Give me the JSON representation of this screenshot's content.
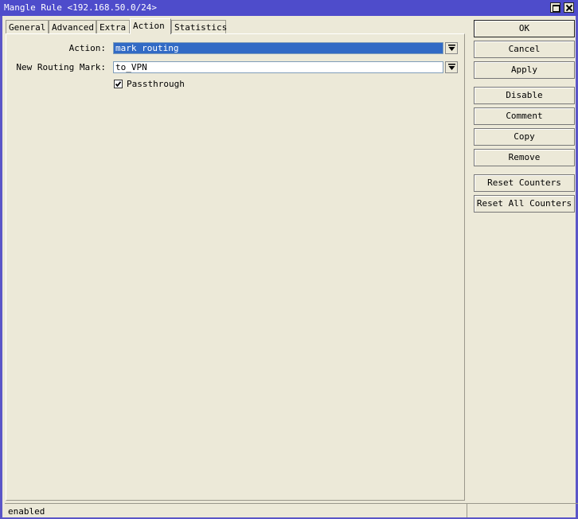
{
  "window": {
    "title": "Mangle Rule <192.168.50.0/24>"
  },
  "tabs": [
    {
      "label": "General"
    },
    {
      "label": "Advanced"
    },
    {
      "label": "Extra"
    },
    {
      "label": "Action",
      "active": true
    },
    {
      "label": "Statistics"
    }
  ],
  "form": {
    "action_label": "Action:",
    "action_value": "mark routing",
    "routing_mark_label": "New Routing Mark:",
    "routing_mark_value": "to_VPN",
    "passthrough_label": "Passthrough",
    "passthrough_checked": true
  },
  "buttons": {
    "ok": "OK",
    "cancel": "Cancel",
    "apply": "Apply",
    "disable": "Disable",
    "comment": "Comment",
    "copy": "Copy",
    "remove": "Remove",
    "reset_counters": "Reset Counters",
    "reset_all_counters": "Reset All Counters"
  },
  "status": {
    "text": "enabled"
  },
  "colors": {
    "titlebar": "#4e4ccb",
    "selection": "#316ac5",
    "background": "#ece9d8"
  },
  "icons": {
    "maximize": "maximize-icon",
    "close": "close-icon",
    "dropdown": "dropdown-arrow-icon",
    "check": "checkmark-icon"
  }
}
